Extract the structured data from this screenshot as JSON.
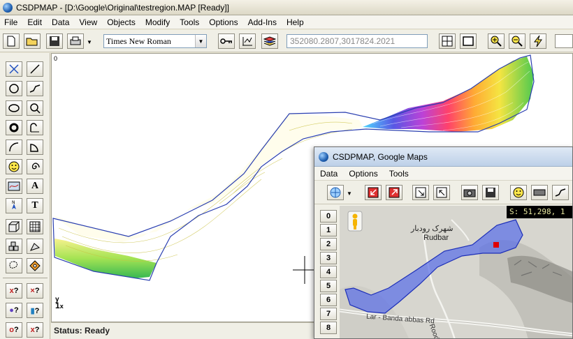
{
  "window": {
    "title": "CSDPMAP - [D:\\Google\\Original\\testregion.MAP [Ready]]"
  },
  "menu": [
    "File",
    "Edit",
    "Data",
    "View",
    "Objects",
    "Modify",
    "Tools",
    "Options",
    "Add-Ins",
    "Help"
  ],
  "toolbar": {
    "font_value": "Times New Roman",
    "coord_value": "352080.2807,3017824.2021"
  },
  "canvas": {
    "origin_label": "0",
    "axis_y": "y",
    "axis_one": "1",
    "axis_x": "x"
  },
  "status": {
    "text": "Status: Ready"
  },
  "google_window": {
    "title": "CSDPMAP, Google Maps",
    "menu": [
      "Data",
      "Options",
      "Tools"
    ],
    "row_buttons": [
      "0",
      "1",
      "2",
      "3",
      "4",
      "5",
      "6",
      "7",
      "8"
    ],
    "scale_readout": "S: 51,298, 1",
    "map_labels": {
      "city_fa": "شهرک رودبار",
      "city_en": "Rudbar",
      "road_main": "Lar - Banda abbas Rd",
      "road_side": "Roodbar"
    }
  },
  "colors": {
    "polygon_fill": "#5a6fe8",
    "polygon_stroke": "#1d2fb8",
    "marker": "#e00000",
    "boundary": "#2a3fb0"
  }
}
